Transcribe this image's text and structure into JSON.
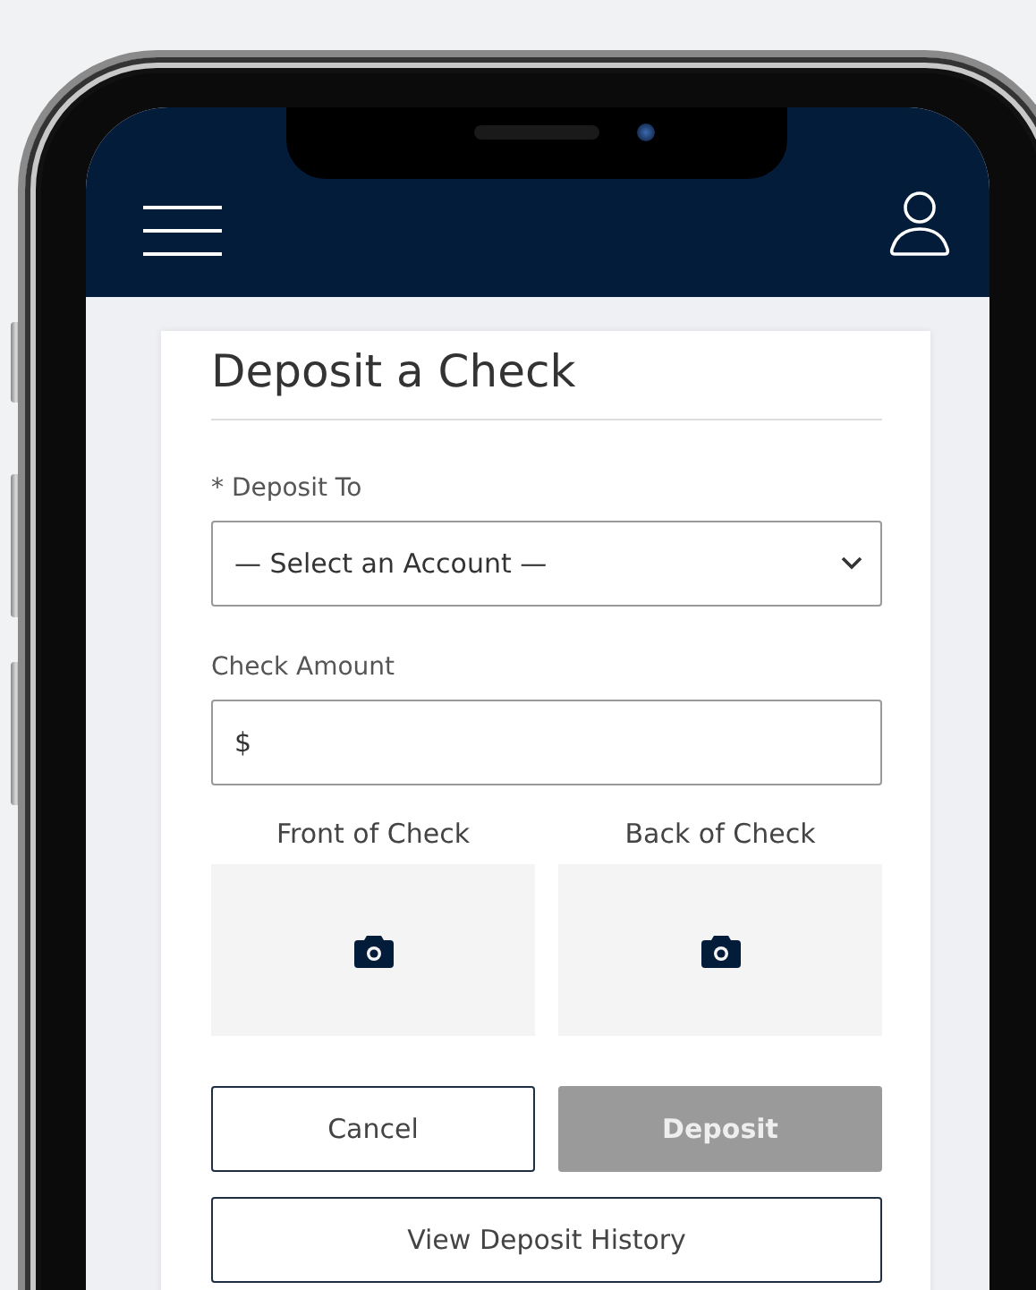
{
  "title": "Deposit a Check",
  "deposit_to": {
    "label": "* Deposit To",
    "value": "— Select an Account —"
  },
  "check_amount": {
    "label": "Check Amount",
    "value": "$"
  },
  "check_images": [
    {
      "label": "Front of Check"
    },
    {
      "label": "Back of Check"
    }
  ],
  "buttons": [
    {
      "label": "Cancel",
      "kind": "outline",
      "disabled": false
    },
    {
      "label": "Deposit",
      "kind": "primary",
      "disabled": true
    }
  ],
  "history_button": {
    "label": "View Deposit History"
  }
}
